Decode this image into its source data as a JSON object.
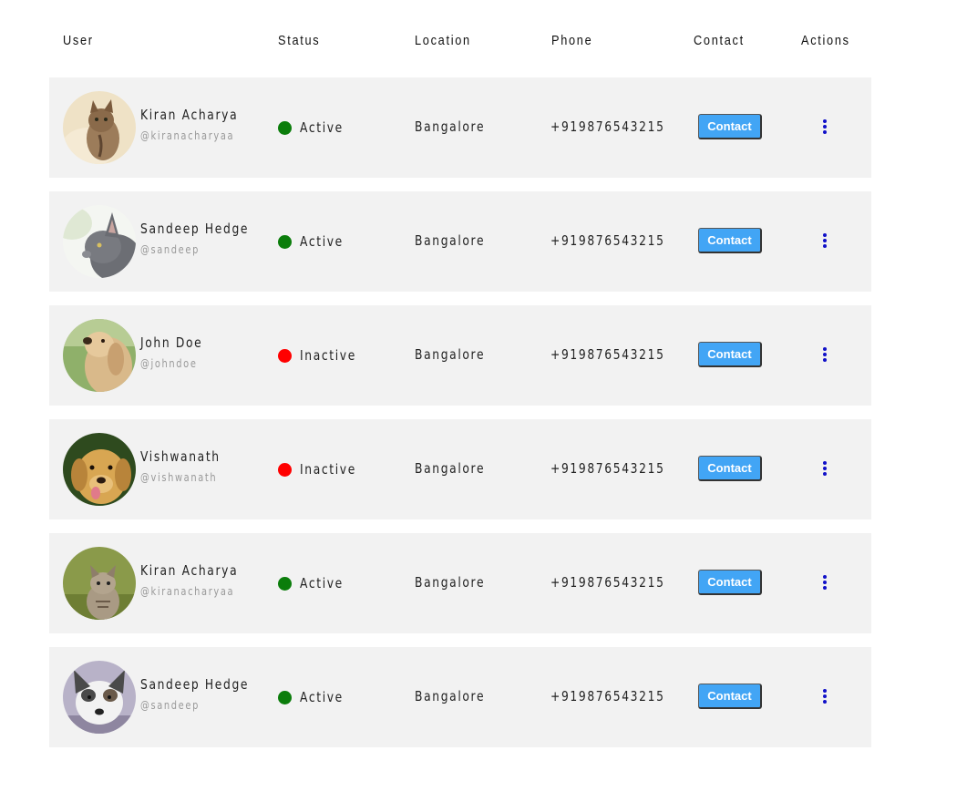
{
  "header": {
    "user": "User",
    "status": "Status",
    "location": "Location",
    "phone": "Phone",
    "contact": "Contact",
    "actions": "Actions"
  },
  "colors": {
    "active": "#0b7d0b",
    "inactive": "#ff0000",
    "button": "#42a5f5",
    "row_bg": "#f2f2f2",
    "kebab": "#1010c8"
  },
  "rows": [
    {
      "name": "Kiran Acharya",
      "handle": "@kiranacharyaa",
      "status": "Active",
      "location": "Bangalore",
      "phone": "+919876543215",
      "contact_label": "Contact",
      "avatar_icon": "kitten-photo-icon"
    },
    {
      "name": "Sandeep Hedge",
      "handle": "@sandeep",
      "status": "Active",
      "location": "Bangalore",
      "phone": "+919876543215",
      "contact_label": "Contact",
      "avatar_icon": "grey-cat-photo-icon"
    },
    {
      "name": "John Doe",
      "handle": "@johndoe",
      "status": "Inactive",
      "location": "Bangalore",
      "phone": "+919876543215",
      "contact_label": "Contact",
      "avatar_icon": "golden-puppy-photo-icon"
    },
    {
      "name": "Vishwanath",
      "handle": "@vishwanath",
      "status": "Inactive",
      "location": "Bangalore",
      "phone": "+919876543215",
      "contact_label": "Contact",
      "avatar_icon": "labrador-photo-icon"
    },
    {
      "name": "Kiran Acharya",
      "handle": "@kiranacharyaa",
      "status": "Active",
      "location": "Bangalore",
      "phone": "+919876543215",
      "contact_label": "Contact",
      "avatar_icon": "tabby-kitten-photo-icon"
    },
    {
      "name": "Sandeep Hedge",
      "handle": "@sandeep",
      "status": "Active",
      "location": "Bangalore",
      "phone": "+919876543215",
      "contact_label": "Contact",
      "avatar_icon": "husky-dog-photo-icon"
    }
  ]
}
